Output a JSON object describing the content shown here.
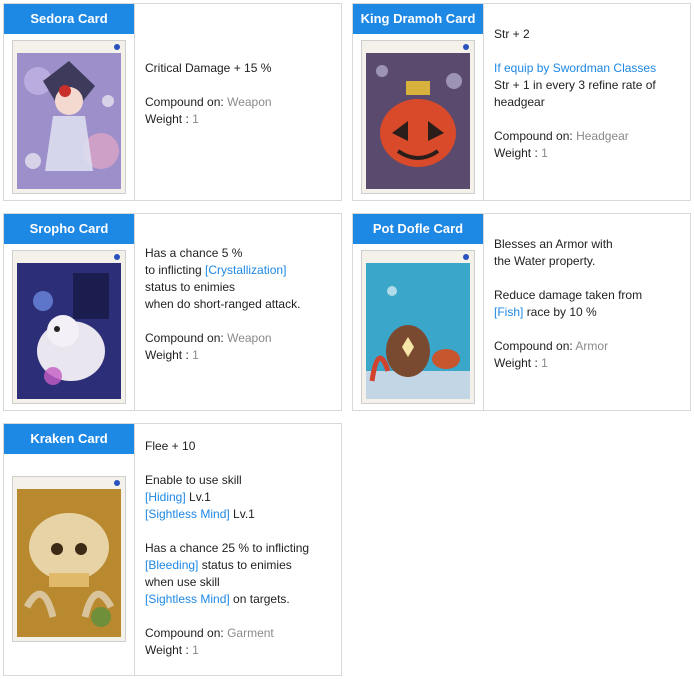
{
  "colors": {
    "title_bg": "#1e88e5",
    "link": "#1e88e5",
    "value": "#8a8a8a",
    "border": "#d8d8d8"
  },
  "labels": {
    "compound": "Compound on:",
    "weight": "Weight :"
  },
  "cards": [
    {
      "name": "Sedora Card",
      "art_label": "SEDORA",
      "lines": [
        "Critical Damage + 15 %"
      ],
      "compound": "Weapon",
      "weight": "1"
    },
    {
      "name": "King Dramoh Card",
      "art_label": "KING DRAMOH",
      "lines": [
        "Str + 2",
        "If equip by Swordman Classes",
        "Str + 1 in every 3 refine rate of",
        "headgear"
      ],
      "compound": "Headgear",
      "weight": "1"
    },
    {
      "name": "Sropho Card",
      "art_label": "SROPHO",
      "lines": [
        "Has a chance 5 %",
        "to inflicting",
        "[Crystallization]",
        "status to enimies",
        "when do short-ranged attack."
      ],
      "compound": "Weapon",
      "weight": "1"
    },
    {
      "name": "Pot Dofle Card",
      "art_label": "POT DOFLE",
      "lines": [
        "Blesses an Armor with",
        "the Water property.",
        "Reduce damage taken from",
        "[Fish]",
        "race by 10 %"
      ],
      "compound": "Armor",
      "weight": "1"
    },
    {
      "name": "Kraken Card",
      "art_label": "KRAKEN",
      "lines": [
        "Flee + 10",
        "Enable to use skill",
        "[Hiding]",
        "Lv.1",
        "[Sightless Mind]",
        "Lv.1",
        "Has a chance 25 % to inflicting",
        "[Bleeding]",
        "status to enimies",
        "when use skill",
        "[Sightless Mind]",
        "on targets."
      ],
      "compound": "Garment",
      "weight": "1"
    }
  ]
}
